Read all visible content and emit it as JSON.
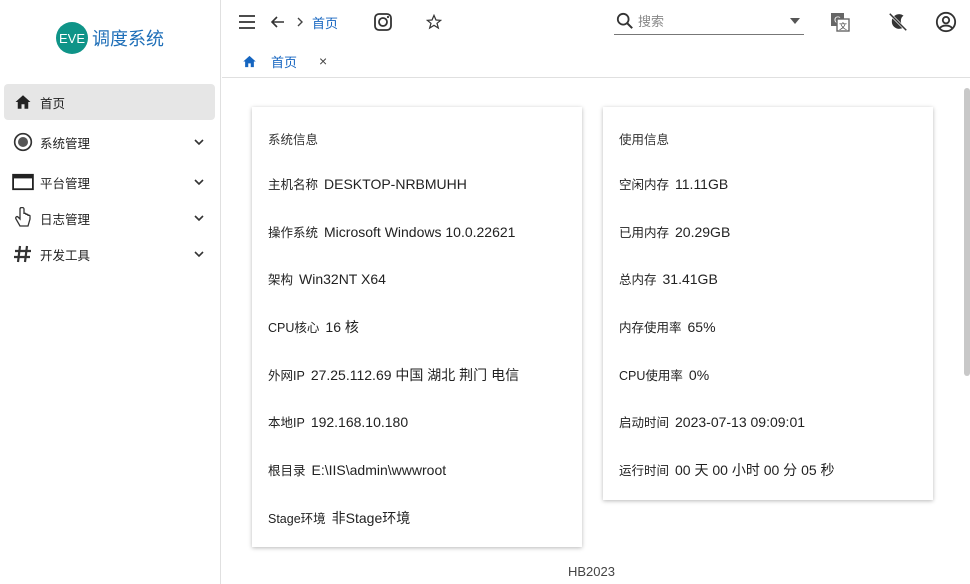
{
  "brand": {
    "logo_text": "EVE",
    "name": "调度系统"
  },
  "sidebar": {
    "items": [
      {
        "label": "首页",
        "icon": "home-icon"
      },
      {
        "label": "系统管理",
        "icon": "record-icon"
      },
      {
        "label": "平台管理",
        "icon": "monitor-icon"
      },
      {
        "label": "日志管理",
        "icon": "pointer-icon"
      },
      {
        "label": "开发工具",
        "icon": "hash-icon"
      }
    ]
  },
  "topbar": {
    "breadcrumb": "首页",
    "search_placeholder": "搜索"
  },
  "tabs": [
    {
      "label": "首页",
      "close": "×"
    }
  ],
  "system_card": {
    "title": "系统信息",
    "rows": [
      {
        "key": "主机名称",
        "value": "DESKTOP-NRBMUHH"
      },
      {
        "key": "操作系统",
        "value": "Microsoft Windows 10.0.22621"
      },
      {
        "key": "架构",
        "value": "Win32NT X64"
      },
      {
        "key": "CPU核心",
        "value": "16 核"
      },
      {
        "key": "外网IP",
        "value": "27.25.112.69 中国 湖北 荆门 电信"
      },
      {
        "key": "本地IP",
        "value": "192.168.10.180"
      },
      {
        "key": "根目录",
        "value": "E:\\IIS\\admin\\wwwroot"
      },
      {
        "key": "Stage环境",
        "value": "非Stage环境"
      }
    ]
  },
  "usage_card": {
    "title": "使用信息",
    "rows": [
      {
        "key": "空闲内存",
        "value": "11.11GB"
      },
      {
        "key": "已用内存",
        "value": "20.29GB"
      },
      {
        "key": "总内存",
        "value": "31.41GB"
      },
      {
        "key": "内存使用率",
        "value": "65%"
      },
      {
        "key": "CPU使用率",
        "value": "0%"
      },
      {
        "key": "启动时间",
        "value": "2023-07-13 09:09:01"
      },
      {
        "key": "运行时间",
        "value": "00 天 00 小时 00 分 05 秒"
      }
    ]
  },
  "footer": {
    "text": "HB2023"
  },
  "colors": {
    "accent": "#1565c0",
    "logo": "#0f9488",
    "brand_text": "#1f6fb8"
  }
}
